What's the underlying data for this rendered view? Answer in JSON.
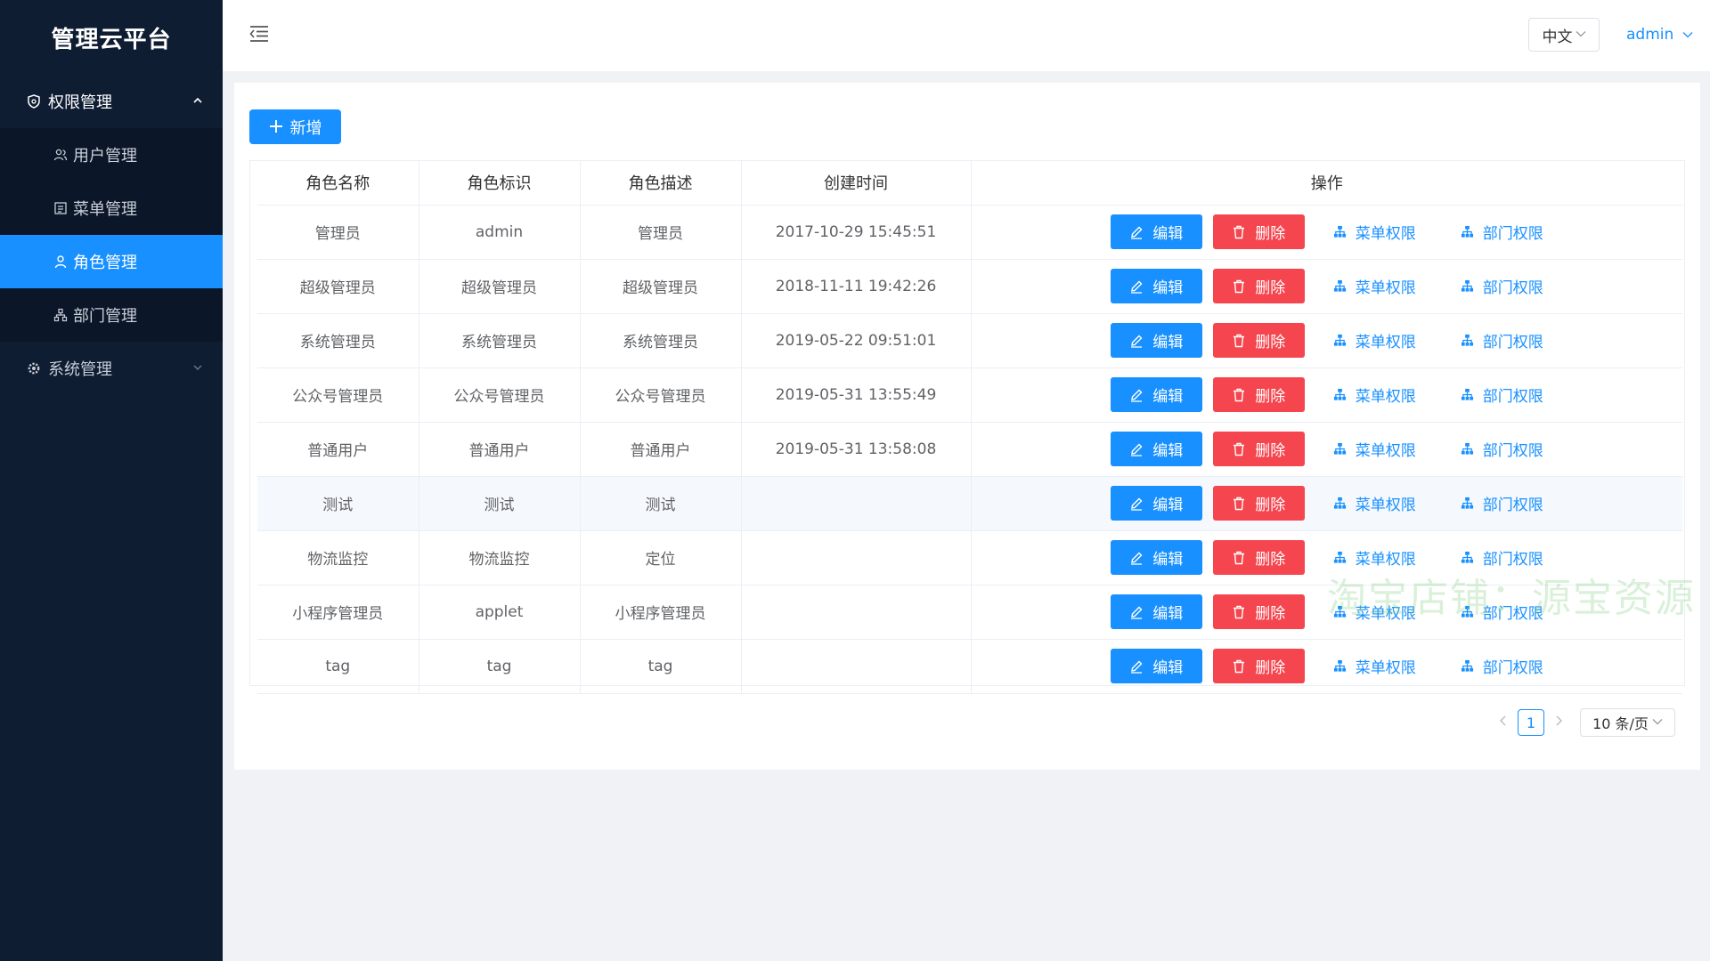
{
  "app": {
    "title": "管理云平台"
  },
  "sidebar": {
    "groups": [
      {
        "label": "权限管理",
        "icon": "shield-icon",
        "expanded": true,
        "items": [
          {
            "label": "用户管理",
            "icon": "users-icon",
            "active": false
          },
          {
            "label": "菜单管理",
            "icon": "menu-list-icon",
            "active": false
          },
          {
            "label": "角色管理",
            "icon": "user-icon",
            "active": true
          },
          {
            "label": "部门管理",
            "icon": "org-icon",
            "active": false
          }
        ]
      },
      {
        "label": "系统管理",
        "icon": "gear-icon",
        "expanded": false,
        "items": []
      }
    ]
  },
  "header": {
    "fold_icon": "indent-icon",
    "language": "中文",
    "user": "admin"
  },
  "toolbar": {
    "add_label": "新增"
  },
  "table": {
    "columns": [
      "角色名称",
      "角色标识",
      "角色描述",
      "创建时间",
      "操作"
    ],
    "rows": [
      {
        "name": "管理员",
        "key": "admin",
        "desc": "管理员",
        "created": "2017-10-29 15:45:51"
      },
      {
        "name": "超级管理员",
        "key": "超级管理员",
        "desc": "超级管理员",
        "created": "2018-11-11 19:42:26"
      },
      {
        "name": "系统管理员",
        "key": "系统管理员",
        "desc": "系统管理员",
        "created": "2019-05-22 09:51:01"
      },
      {
        "name": "公众号管理员",
        "key": "公众号管理员",
        "desc": "公众号管理员",
        "created": "2019-05-31 13:55:49"
      },
      {
        "name": "普通用户",
        "key": "普通用户",
        "desc": "普通用户",
        "created": "2019-05-31 13:58:08"
      },
      {
        "name": "测试",
        "key": "测试",
        "desc": "测试",
        "created": ""
      },
      {
        "name": "物流监控",
        "key": "物流监控",
        "desc": "定位",
        "created": ""
      },
      {
        "name": "小程序管理员",
        "key": "applet",
        "desc": "小程序管理员",
        "created": ""
      },
      {
        "name": "tag",
        "key": "tag",
        "desc": "tag",
        "created": ""
      }
    ],
    "actions": {
      "edit": "编辑",
      "delete": "删除",
      "menu_perm": "菜单权限",
      "dept_perm": "部门权限"
    }
  },
  "pagination": {
    "current": "1",
    "page_size": "10 条/页"
  },
  "watermark": "淘宝店铺：源宝资源",
  "colors": {
    "primary": "#1890ff",
    "danger": "#f5454e",
    "sidebar": "#0f1d33"
  }
}
